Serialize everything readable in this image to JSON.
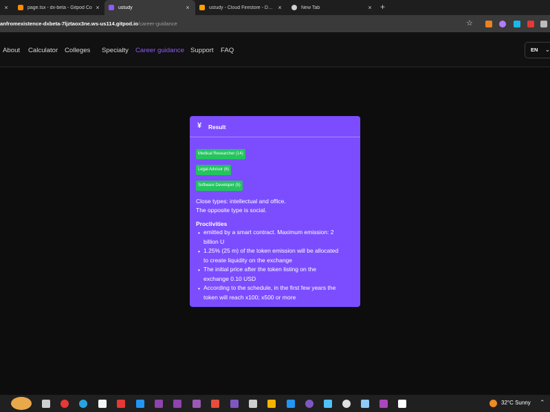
{
  "browser": {
    "tabs": [
      {
        "title": "page.tsx - dx-beta - Gitpod Co",
        "icon": "gitpod-icon",
        "color": "#ff8a00",
        "active": false
      },
      {
        "title": "ustudy",
        "icon": "ustudy-icon",
        "color": "#8b5cf6",
        "active": true
      },
      {
        "title": "ustudy - Cloud Firestore - Data",
        "icon": "firebase-icon",
        "color": "#ffa000",
        "active": false
      },
      {
        "title": "New Tab",
        "icon": "chrome-icon",
        "color": "#cfcfcf",
        "active": false
      }
    ],
    "close_glyph": "×",
    "new_tab_glyph": "+",
    "url_host": "anfromexistence-dxbeta-7ljztaox3ne.ws-us114.gitpod.io",
    "url_path": "/career-guidance",
    "bookmark_glyph": "☆",
    "extensions": [
      "metamask-icon",
      "extension-icon",
      "vimeo-icon",
      "extension-icon",
      "extension-icon"
    ]
  },
  "header": {
    "nav": [
      "About",
      "Calculator",
      "Colleges",
      "Specialty",
      "Career guidance",
      "Support",
      "FAQ"
    ],
    "active_nav": "Career guidance",
    "lang": "EN",
    "lang_chevron": "⌄",
    "accent": "#8b5cf6"
  },
  "result": {
    "icon": "yen-icon",
    "icon_glyph": "¥",
    "title": "Result",
    "badges": [
      "Medical Researcher (14)",
      "Legal Advisor (6)",
      "Software Developer (5)"
    ],
    "close_types": "Close types: intellectual and office.",
    "opposite_type": "The opposite type is social.",
    "proclivities_title": "Proclivities",
    "proclivities": [
      {
        "line1": "emitted by a smart contract. Maximum emission: 2",
        "line2": "billion U"
      },
      {
        "line1": "1.25% (25 m) of the token emission will be allocated",
        "line2": "to create liquidity on the exchange"
      },
      {
        "line1": "The initial price after the token listing on the",
        "line2": "exchange 0.10 USD"
      },
      {
        "line1": "According to the schedule, in the first few years the",
        "line2": "token will reach x100; x500 or more"
      }
    ],
    "card_color": "#7c4dff",
    "badge_color": "#22c55e"
  },
  "taskbar": {
    "weather": "32°C  Sunny",
    "tray_more": "⌃"
  }
}
